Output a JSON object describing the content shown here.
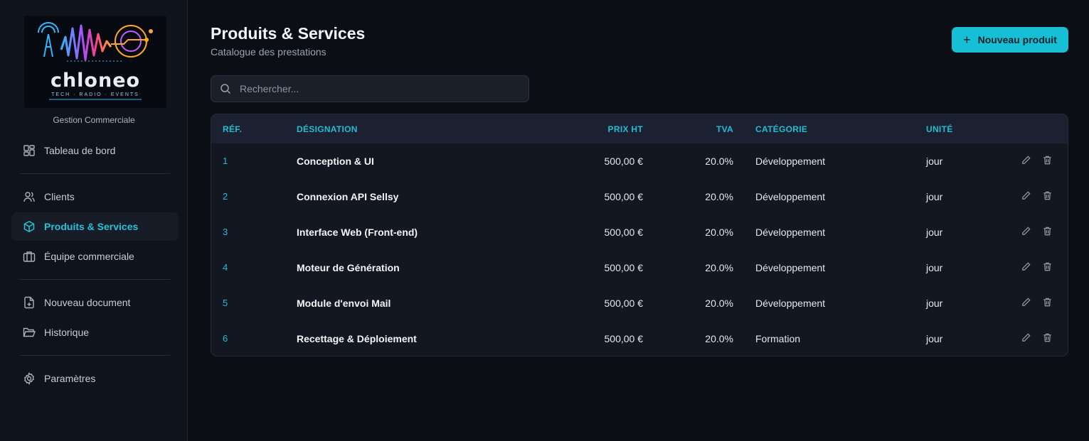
{
  "brand": {
    "name": "chloneo",
    "tagline": "TECH · RADIO · EVENTS",
    "app_subtitle": "Gestion Commerciale"
  },
  "nav": [
    {
      "label": "Tableau de bord",
      "icon": "dashboard-icon",
      "active": false
    },
    {
      "label": "Clients",
      "icon": "users-icon",
      "active": false
    },
    {
      "label": "Produits & Services",
      "icon": "box-icon",
      "active": true
    },
    {
      "label": "Équipe commerciale",
      "icon": "briefcase-icon",
      "active": false
    },
    {
      "label": "Nouveau document",
      "icon": "file-plus-icon",
      "active": false
    },
    {
      "label": "Historique",
      "icon": "folder-open-icon",
      "active": false
    },
    {
      "label": "Paramètres",
      "icon": "gear-icon",
      "active": false
    }
  ],
  "header": {
    "title": "Produits & Services",
    "subtitle": "Catalogue des prestations",
    "new_button": "Nouveau produit"
  },
  "search": {
    "placeholder": "Rechercher..."
  },
  "table": {
    "columns": [
      "RÉF.",
      "DÉSIGNATION",
      "PRIX HT",
      "TVA",
      "CATÉGORIE",
      "UNITÉ"
    ],
    "rows": [
      {
        "ref": "1",
        "designation": "Conception & UI",
        "prix": "500,00 €",
        "tva": "20.0%",
        "categorie": "Développement",
        "unite": "jour"
      },
      {
        "ref": "2",
        "designation": "Connexion API Sellsy",
        "prix": "500,00 €",
        "tva": "20.0%",
        "categorie": "Développement",
        "unite": "jour"
      },
      {
        "ref": "3",
        "designation": "Interface Web (Front-end)",
        "prix": "500,00 €",
        "tva": "20.0%",
        "categorie": "Développement",
        "unite": "jour"
      },
      {
        "ref": "4",
        "designation": "Moteur de Génération",
        "prix": "500,00 €",
        "tva": "20.0%",
        "categorie": "Développement",
        "unite": "jour"
      },
      {
        "ref": "5",
        "designation": "Module d'envoi Mail",
        "prix": "500,00 €",
        "tva": "20.0%",
        "categorie": "Développement",
        "unite": "jour"
      },
      {
        "ref": "6",
        "designation": "Recettage & Déploiement",
        "prix": "500,00 €",
        "tva": "20.0%",
        "categorie": "Formation",
        "unite": "jour"
      }
    ]
  },
  "colors": {
    "accent": "#16bfd4",
    "background": "#0b0e15",
    "sidebar": "#0f131b"
  }
}
